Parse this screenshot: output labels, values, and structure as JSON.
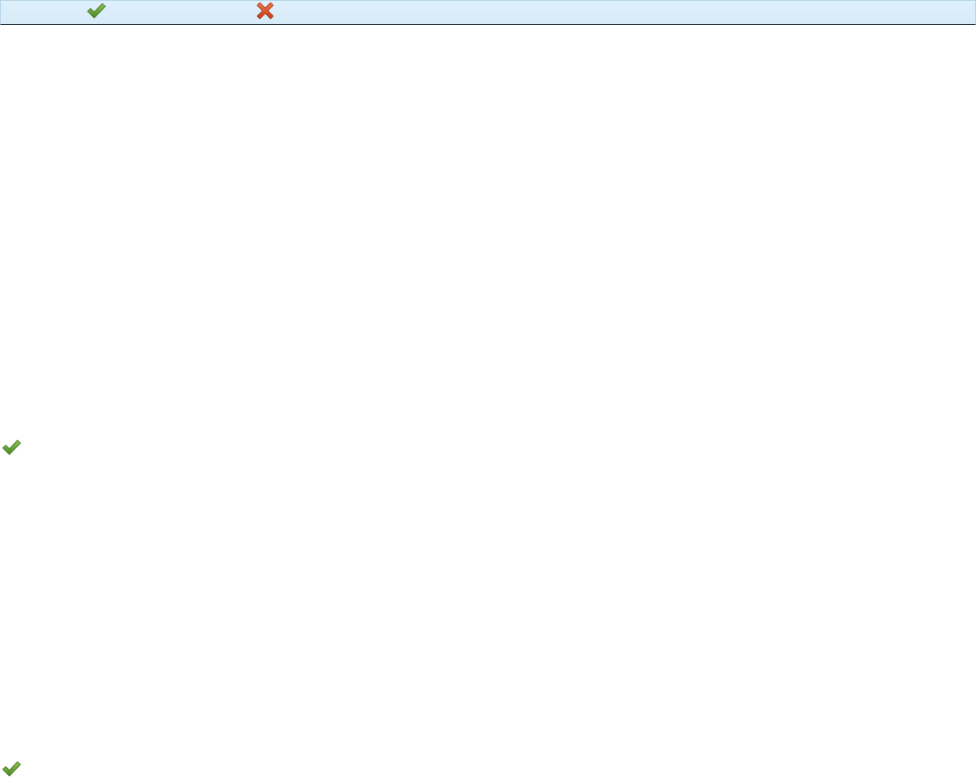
{
  "toolbar": {
    "buttons": [
      {
        "icon": "check-icon",
        "color": "#5f9b2e"
      },
      {
        "icon": "close-icon",
        "color": "#d9542c"
      }
    ]
  },
  "rows": [
    {
      "status_icon": "check-icon"
    },
    {
      "status_icon": "check-icon"
    }
  ],
  "colors": {
    "toolbar_bg": "#dbeefa",
    "toolbar_border": "#b9d6ea",
    "accept_green": "#5f9b2e",
    "reject_red": "#d9542c"
  }
}
